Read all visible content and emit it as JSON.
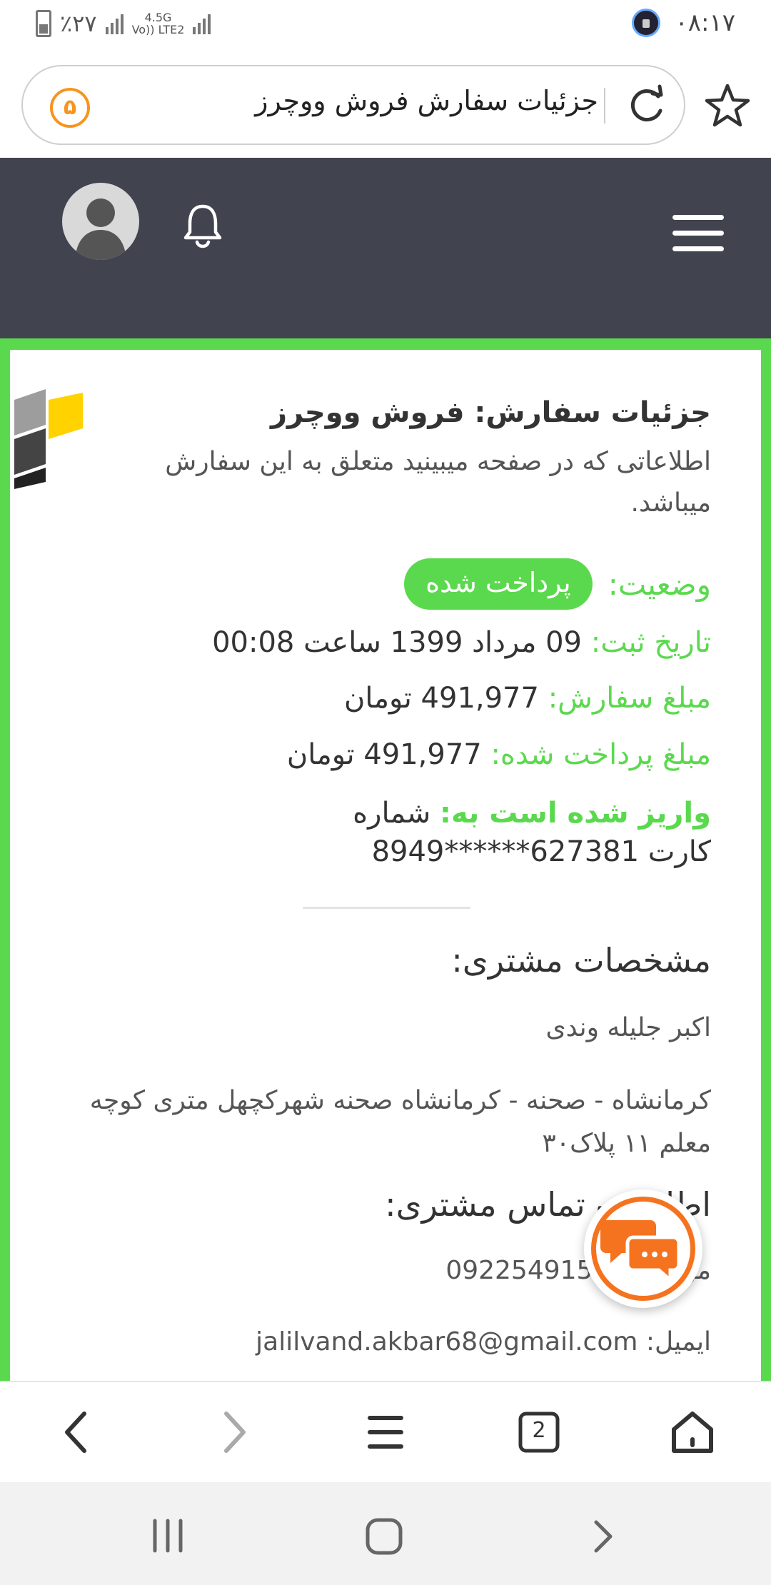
{
  "status_bar": {
    "battery": "٪۲۷",
    "network": [
      "4.5G",
      "Vo)) LTE2"
    ],
    "time": "۰۸:۱۷"
  },
  "browser": {
    "url_text": "جزئیات سفارش فروش ووچرز",
    "site_icon_glyph": "۵",
    "tab_count": "2"
  },
  "order": {
    "title": "جزئیات سفارش: فروش ووچرز",
    "subtitle": "اطلاعاتی که در صفحه میبینید متعلق به این سفارش میباشد.",
    "status_label": "وضعیت:",
    "status_value": "پرداخت شده",
    "date_label": "تاریخ ثبت:",
    "date_value": "09 مرداد 1399 ساعت 00:08",
    "amount_label": "مبلغ سفارش:",
    "amount_value": "491,977 تومان",
    "paid_label": "مبلغ پرداخت شده:",
    "paid_value": "491,977 تومان",
    "deposit_label": "واریز شده است به:",
    "deposit_value": "شماره کارت 627381******8949"
  },
  "customer": {
    "heading": "مشخصات مشتری:",
    "name": "اکبر جلیله وندی",
    "address": "کرمانشاه - صحنه - کرمانشاه صحنه شهرکچهل متری کوچه معلم ۱۱ پلاک۳۰"
  },
  "contact": {
    "heading": "اطلاعات تماس مشتری:",
    "mobile_label": "موبایل:",
    "mobile_value": "09225491581",
    "email_label": "ایمیل:",
    "email_value": "jalilvand.akbar68@gmail.com"
  },
  "colors": {
    "accent_green": "#5bd94e",
    "header_dark": "#41434f",
    "chat_orange": "#f5731f"
  },
  "icons": [
    "battery-icon",
    "signal-icon",
    "vpn-lock-icon",
    "site-icon",
    "reload-icon",
    "star-icon",
    "avatar-icon",
    "bell-icon",
    "hamburger-menu-icon",
    "logo-icon",
    "chat-icon",
    "back-icon",
    "forward-icon",
    "menu-icon",
    "tabs-icon",
    "home-icon",
    "recents-icon",
    "home-circle-icon",
    "back-chevron-icon"
  ]
}
